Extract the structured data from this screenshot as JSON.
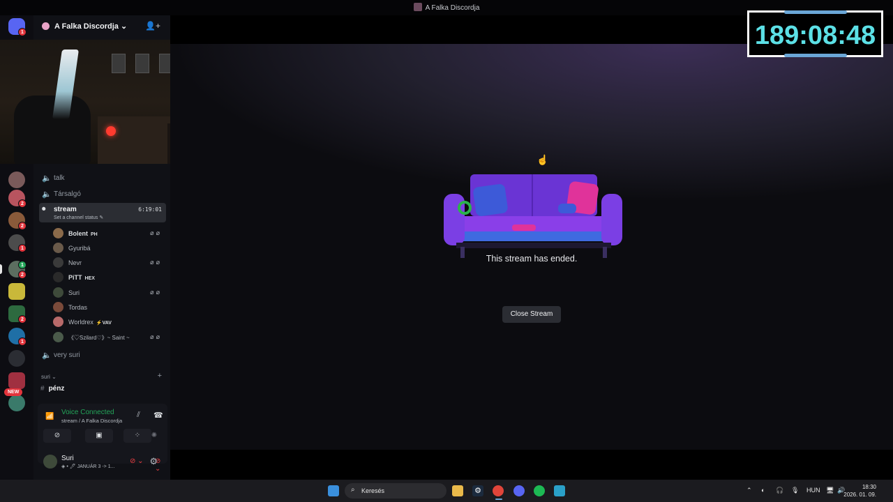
{
  "window": {
    "title": "A Falka Discordja"
  },
  "server": {
    "name": "A Falka Discordja"
  },
  "channels": {
    "partial_top": "stream",
    "voice": [
      {
        "name": "talk"
      },
      {
        "name": "Társalgó"
      }
    ],
    "active": {
      "name": "stream",
      "status_placeholder": "Set a channel status",
      "timer": "6:19:01"
    },
    "users": [
      {
        "name": "Bolent",
        "tag": "PH",
        "muted": true
      },
      {
        "name": "Gyuribá",
        "tag": "",
        "muted": false
      },
      {
        "name": "Nevr",
        "tag": "",
        "muted": true
      },
      {
        "name": "PiTT",
        "tag": "HEX",
        "muted": false
      },
      {
        "name": "Suri",
        "tag": "",
        "muted": true
      },
      {
        "name": "Tordas",
        "tag": "",
        "muted": false
      },
      {
        "name": "Worldrex",
        "tag": "VAV",
        "muted": false
      },
      {
        "name": "《♡Szilard♡》~ Saint ~",
        "tag": "",
        "muted": true
      }
    ],
    "after": {
      "name": "very suri"
    },
    "category": "suri",
    "text_channel": "pénz"
  },
  "voice_panel": {
    "status": "Voice Connected",
    "location": "stream / A Falka Discordja"
  },
  "user": {
    "name": "Suri",
    "status": "JANUÁR 3 -> 1..."
  },
  "main": {
    "ended_text": "This stream has ended.",
    "close_label": "Close Stream"
  },
  "overlay_timer": "189:08:48",
  "rail_badges": [
    "1",
    "2",
    "2",
    "1",
    "1",
    "2",
    "2",
    "1",
    "2"
  ],
  "rail_new": "NEW",
  "taskbar": {
    "search_placeholder": "Keresés",
    "lang": "HUN",
    "time": "18:30",
    "date": "2026. 01. 09."
  },
  "colors": {
    "connected": "#23a559",
    "timer_text": "#5ce0e6",
    "badge": "#e3343c",
    "accent_purple": "#7b3fe4"
  }
}
